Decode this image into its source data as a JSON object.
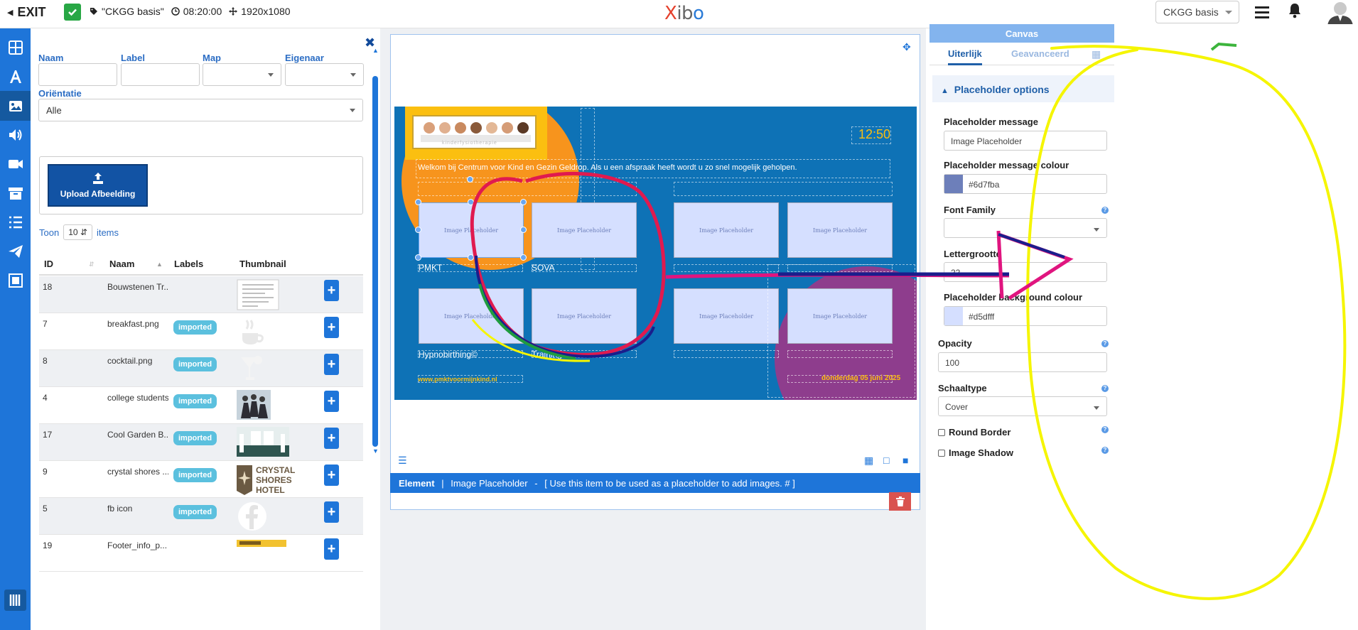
{
  "topbar": {
    "exit_label": "EXIT",
    "layout_name": "\"CKGG basis\"",
    "duration": "08:20:00",
    "resolution": "1920x1080",
    "logo": {
      "x": "X",
      "ib": "ib",
      "o": "o"
    },
    "layout_select": "CKGG basis"
  },
  "library": {
    "filters": {
      "naam_label": "Naam",
      "label_label": "Label",
      "map_label": "Map",
      "eigenaar_label": "Eigenaar",
      "orientatie_label": "Oriëntatie",
      "orientatie_value": "Alle"
    },
    "upload_label": "Upload Afbeelding",
    "toon_label": "Toon",
    "page_size": "10",
    "items_label": "items",
    "columns": {
      "id": "ID",
      "naam": "Naam",
      "labels": "Labels",
      "thumbnail": "Thumbnail"
    },
    "rows": [
      {
        "id": "18",
        "name": "Bouwstenen Tr...",
        "badge": ""
      },
      {
        "id": "7",
        "name": "breakfast.png",
        "badge": "imported"
      },
      {
        "id": "8",
        "name": "cocktail.png",
        "badge": "imported"
      },
      {
        "id": "4",
        "name": "college students",
        "badge": "imported"
      },
      {
        "id": "17",
        "name": "Cool Garden B...",
        "badge": "imported"
      },
      {
        "id": "9",
        "name": "crystal shores ...",
        "badge": "imported"
      },
      {
        "id": "5",
        "name": "fb icon",
        "badge": "imported"
      },
      {
        "id": "19",
        "name": "Footer_info_p...",
        "badge": ""
      }
    ],
    "crystal_thumb": {
      "l1": "CRYSTAL",
      "l2": "SHORES",
      "l3": "HOTEL"
    }
  },
  "canvas": {
    "clock": "12:50",
    "welcome": "Welkom bij Centrum voor Kind en Gezin Geldrop. Als u een afspraak heeft wordt u zo snel mogelijk geholpen.",
    "placeholder_text": "Image Placeholder",
    "captions": [
      "PMKT",
      "SOVA",
      "Hypnobirthing©",
      "Trainingen"
    ],
    "website": "www.pmktvoormijnkind.nl",
    "date": "donderdag 05 juni 2025",
    "logo_sub": "kinderfysiotherapie"
  },
  "element_bar": {
    "kind": "Element",
    "name": "Image Placeholder",
    "description": "[ Use this item to be used as a placeholder to add images. # ]"
  },
  "properties": {
    "header": "Canvas",
    "tab_uiterlijk": "Uiterlijk",
    "tab_geavanceerd": "Geavanceerd",
    "section": "Placeholder options",
    "placeholder_message_label": "Placeholder message",
    "placeholder_message_value": "Image Placeholder",
    "message_colour_label": "Placeholder message colour",
    "message_colour_value": "#6d7fba",
    "font_family_label": "Font Family",
    "font_size_label": "Lettergrootte",
    "font_size_value": "22",
    "bg_colour_label": "Placeholder background colour",
    "bg_colour_value": "#d5dfff",
    "opacity_label": "Opacity",
    "opacity_value": "100",
    "scale_label": "Schaaltype",
    "scale_value": "Cover",
    "round_border_label": "Round Border",
    "image_shadow_label": "Image Shadow"
  },
  "colors": {
    "accent": "#1e75d9",
    "placeholder_text": "#6d7fba",
    "placeholder_bg": "#d5dfff",
    "annotation_yellow": "#f5f500",
    "annotation_magenta": "#e0157f",
    "annotation_navy": "#1a1e8c"
  }
}
